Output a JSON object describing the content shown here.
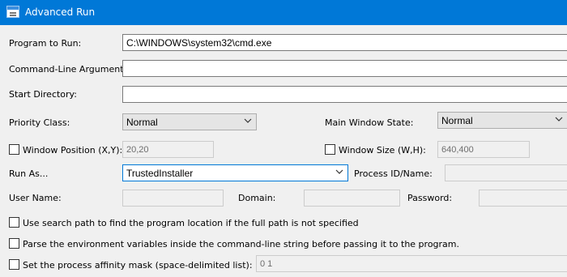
{
  "window": {
    "title": "Advanced Run",
    "icon": "app-window-icon"
  },
  "program": {
    "label": "Program to Run:",
    "value": "C:\\WINDOWS\\system32\\cmd.exe"
  },
  "arguments": {
    "label": "Command-Line Arguments:",
    "value": ""
  },
  "start_dir": {
    "label": "Start Directory:",
    "value": ""
  },
  "priority": {
    "label": "Priority Class:",
    "selected": "Normal"
  },
  "window_state": {
    "label": "Main Window State:",
    "selected": "Normal"
  },
  "window_position": {
    "label": "Window Position (X,Y):",
    "value": "20,20",
    "checked": false
  },
  "window_size": {
    "label": "Window Size (W,H):",
    "value": "640,400",
    "checked": false
  },
  "run_as": {
    "label": "Run As...",
    "selected": "TrustedInstaller"
  },
  "process_id": {
    "label": "Process ID/Name:",
    "value": ""
  },
  "user_name": {
    "label": "User Name:",
    "value": ""
  },
  "domain": {
    "label": "Domain:",
    "value": ""
  },
  "password": {
    "label": "Password:",
    "value": ""
  },
  "options": {
    "search_path": {
      "label": "Use search path to find the program location if the full path is not specified",
      "checked": false
    },
    "parse_env": {
      "label": "Parse the environment variables inside the command-line string before passing it to the program.",
      "checked": false
    },
    "affinity": {
      "label": "Set the process affinity mask (space-delimited list):",
      "value": "0 1",
      "checked": false
    }
  },
  "colors": {
    "titlebar": "#0078d7",
    "window_bg": "#f0f0f0",
    "focus_border": "#0078d7"
  }
}
